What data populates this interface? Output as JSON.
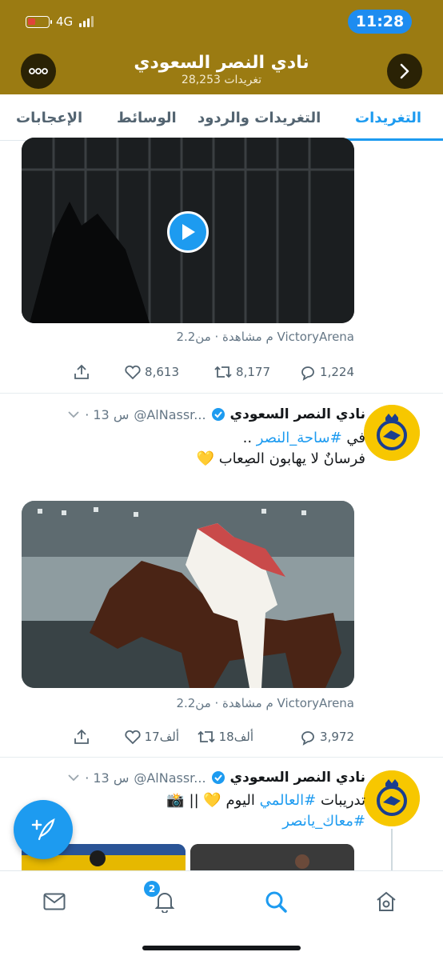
{
  "status_bar": {
    "time": "11:28",
    "network": "4G"
  },
  "header": {
    "title": "نادي النصر السعودي",
    "subtitle": "28,253 تغريدات"
  },
  "tabs": [
    {
      "label": "التغريدات",
      "active": true
    },
    {
      "label": "التغريدات والردود",
      "active": false
    },
    {
      "label": "الوسائط",
      "active": false
    },
    {
      "label": "الإعجابات",
      "active": false
    }
  ],
  "tweet1": {
    "views": "2.2م مشاهدة · من VictoryArena",
    "replies": "1,224",
    "retweets": "8,177",
    "likes": "8,613"
  },
  "tweet2": {
    "name": "نادي النصر السعودي",
    "handle": "@AlNassr...",
    "time": "· 13 س",
    "text_line1_prefix": "في ",
    "text_line1_hashtag": "#ساحة_النصر",
    "text_line1_suffix": " ..",
    "text_line2": "فرسانٌ لا يهابون الصِعاب 💛",
    "views": "2.2م مشاهدة · من VictoryArena",
    "replies": "3,972",
    "retweets": "18ألف",
    "likes": "17ألف"
  },
  "tweet3": {
    "name": "نادي النصر السعودي",
    "handle": "@AlNassr...",
    "time": "· 13 س",
    "text_line1_prefix": "تدريبات ",
    "text_line1_hashtag": "#العالمي",
    "text_line1_suffix": " اليوم 💛 || 📸",
    "text_line2_hashtag": "#معاك_يانصر"
  },
  "bottom_nav": {
    "notifications_badge": "2"
  },
  "colors": {
    "header_gold": "#9b7b12",
    "accent": "#1d9bf0",
    "club_yellow": "#f7c700",
    "club_blue": "#1a3e8f"
  },
  "icons": [
    "more-icon",
    "back-arrow-icon",
    "play-icon",
    "share-icon",
    "heart-icon",
    "retweet-icon",
    "reply-icon",
    "chevron-down-icon",
    "verified-icon",
    "compose-icon",
    "mail-icon",
    "bell-icon",
    "search-icon",
    "home-icon"
  ]
}
